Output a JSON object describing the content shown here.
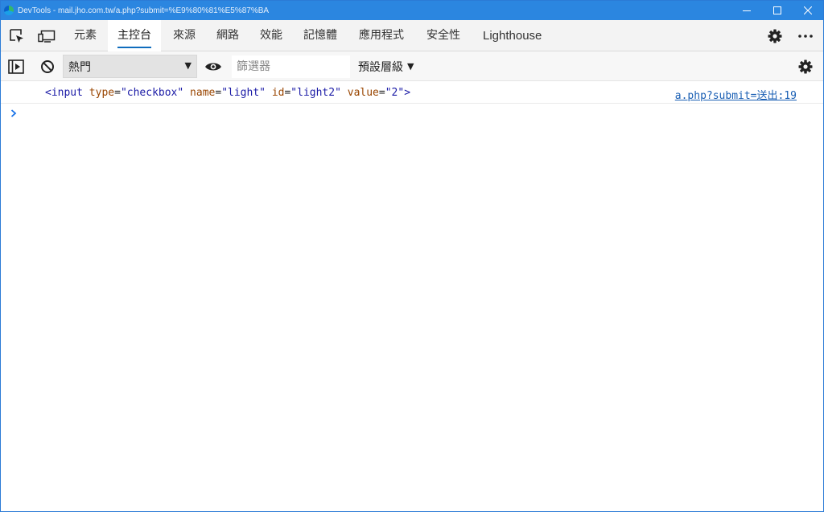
{
  "window": {
    "title": "DevTools - mail.jho.com.tw/a.php?submit=%E9%80%81%E5%87%BA"
  },
  "tabs": [
    {
      "label": "元素"
    },
    {
      "label": "主控台"
    },
    {
      "label": "來源"
    },
    {
      "label": "網路"
    },
    {
      "label": "效能"
    },
    {
      "label": "記憶體"
    },
    {
      "label": "應用程式"
    },
    {
      "label": "安全性"
    },
    {
      "label": "Lighthouse"
    }
  ],
  "active_tab": "主控台",
  "toolbar": {
    "context_value": "熱門",
    "filter_placeholder": "篩選器",
    "levels_label": "預設層級"
  },
  "console": {
    "message": {
      "open": "<input",
      "a1_name": "type",
      "a1_value": "\"checkbox\"",
      "a2_name": "name",
      "a2_value": "\"light\"",
      "a3_name": "id",
      "a3_value": "\"light2\"",
      "a4_name": "value",
      "a4_value": "\"2\"",
      "close": ">"
    },
    "source_link": "a.php?submit=送出:19"
  },
  "colors": {
    "titlebar": "#2b86e0",
    "accent": "#0f6cbd",
    "tag": "#1a1aa6",
    "attribute_name": "#994500"
  }
}
